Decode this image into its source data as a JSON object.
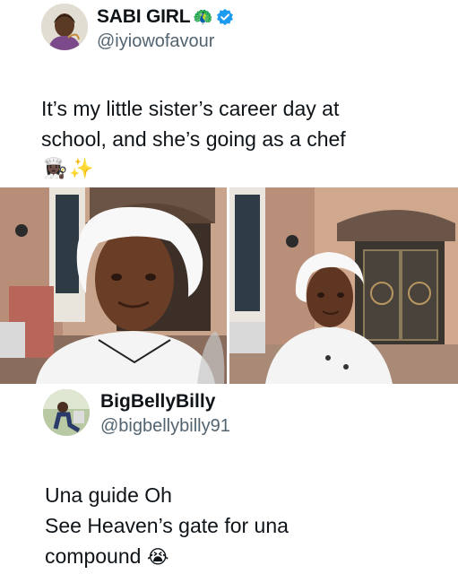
{
  "post": {
    "author_name": "SABI GIRL",
    "author_emoji": "🦚",
    "handle": "@iyiowofavour",
    "verified": true,
    "text_lines": [
      "It’s my little sister’s career day at",
      "school, and she’s going as a chef"
    ],
    "emojis": [
      "👩🏿‍🍳",
      "✨"
    ],
    "photos": [
      {
        "icon": "girl-in-chef-hat-selfie-photo"
      },
      {
        "icon": "girl-in-chef-uniform-at-gate-photo"
      }
    ]
  },
  "reply": {
    "author_name": "BigBellyBilly",
    "handle": "@bigbellybilly91",
    "text_lines": [
      "Una guide Oh",
      "See Heaven’s gate for una",
      "compound"
    ],
    "trailing_emoji": "😭"
  },
  "colors": {
    "text": "#0f1419",
    "secondary_text": "#536471",
    "verified_blue": "#1d9bf0",
    "background": "#ffffff"
  }
}
